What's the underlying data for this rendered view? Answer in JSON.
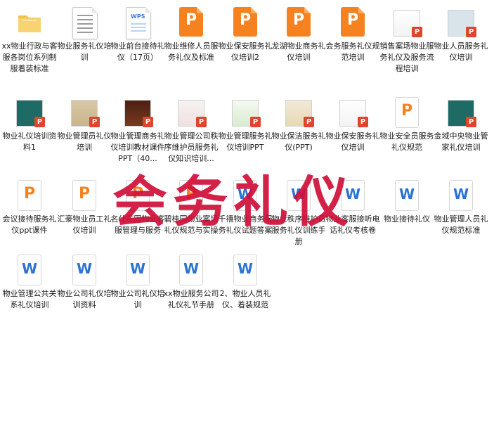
{
  "watermark": "会务礼仪",
  "colors": {
    "ppt_orange": "#f5821f",
    "word_blue": "#2c73d2",
    "badge_red": "#e0442e",
    "watermark_red": "#d10f38"
  },
  "files": [
    {
      "name": "xx物业行政与客服各岗位系列制服着装标准",
      "icon": "folder-icon"
    },
    {
      "name": "物业服务礼仪培训",
      "icon": "text-document-icon"
    },
    {
      "name": "物业前台接待礼仪（17页）",
      "icon": "wps-document-icon"
    },
    {
      "name": "物业维修人员服务礼仪及标准",
      "icon": "ppt-file-icon"
    },
    {
      "name": "物业保安服务礼仪培训2",
      "icon": "ppt-file-icon"
    },
    {
      "name": "龙湖物业商务礼仪培训",
      "icon": "ppt-file-icon"
    },
    {
      "name": "会务服务礼仪规范培训",
      "icon": "ppt-file-icon"
    },
    {
      "name": "销售案场物业服务礼仪及服务流程培训",
      "icon": "ppt-thumbnail-icon"
    },
    {
      "name": "物业人员服务礼仪培训",
      "icon": "ppt-thumbnail-icon"
    },
    {
      "name": "物业礼仪培训资料1",
      "icon": "ppt-thumbnail-icon"
    },
    {
      "name": "物业管理员礼仪培训",
      "icon": "ppt-thumbnail-icon"
    },
    {
      "name": "物业管理商务礼仪培训教材课件PPT（40...",
      "icon": "ppt-thumbnail-icon"
    },
    {
      "name": "物业管理公司秩序维护员服务礼仪知识培训...",
      "icon": "ppt-thumbnail-icon"
    },
    {
      "name": "物业管理服务礼仪培训PPT",
      "icon": "ppt-thumbnail-icon"
    },
    {
      "name": "物业保洁服务礼仪(PPT)",
      "icon": "ppt-thumbnail-icon"
    },
    {
      "name": "物业保安服务礼仪培训",
      "icon": "ppt-thumbnail-icon"
    },
    {
      "name": "物业安全员服务礼仪规范",
      "icon": "ppt-outline-icon"
    },
    {
      "name": "金域中央物业管家礼仪培训",
      "icon": "ppt-thumbnail-icon"
    },
    {
      "name": "会议接待服务礼仪ppt课件",
      "icon": "ppt-outline-icon"
    },
    {
      "name": "汇豪物业员工礼仪培训",
      "icon": "ppt-outline-icon"
    },
    {
      "name": "名仕花园物业客服管理与服务",
      "icon": "ppt-outline-icon"
    },
    {
      "name": "碧桂园物业案场礼仪规范与实操",
      "icon": "ppt-outline-icon"
    },
    {
      "name": "千禧物业商务服务礼仪试题答案",
      "icon": "word-file-icon"
    },
    {
      "name": "物业秩序维护员服务礼仪训练手册",
      "icon": "word-file-icon"
    },
    {
      "name": "物业客服接听电话礼仪考核卷",
      "icon": "word-file-icon"
    },
    {
      "name": "物业接待礼仪",
      "icon": "word-file-icon"
    },
    {
      "name": "物业管理人员礼仪规范标准",
      "icon": "word-file-icon"
    },
    {
      "name": "物业管理公共关系礼仪培训",
      "icon": "word-file-icon"
    },
    {
      "name": "物业公司礼仪培训资料",
      "icon": "word-file-icon"
    },
    {
      "name": "物业公司礼仪培训",
      "icon": "word-file-icon"
    },
    {
      "name": "xx物业服务公司礼仪礼节手册",
      "icon": "word-file-icon"
    },
    {
      "name": "2、物业人员礼仪、着装规范",
      "icon": "word-file-icon"
    }
  ]
}
